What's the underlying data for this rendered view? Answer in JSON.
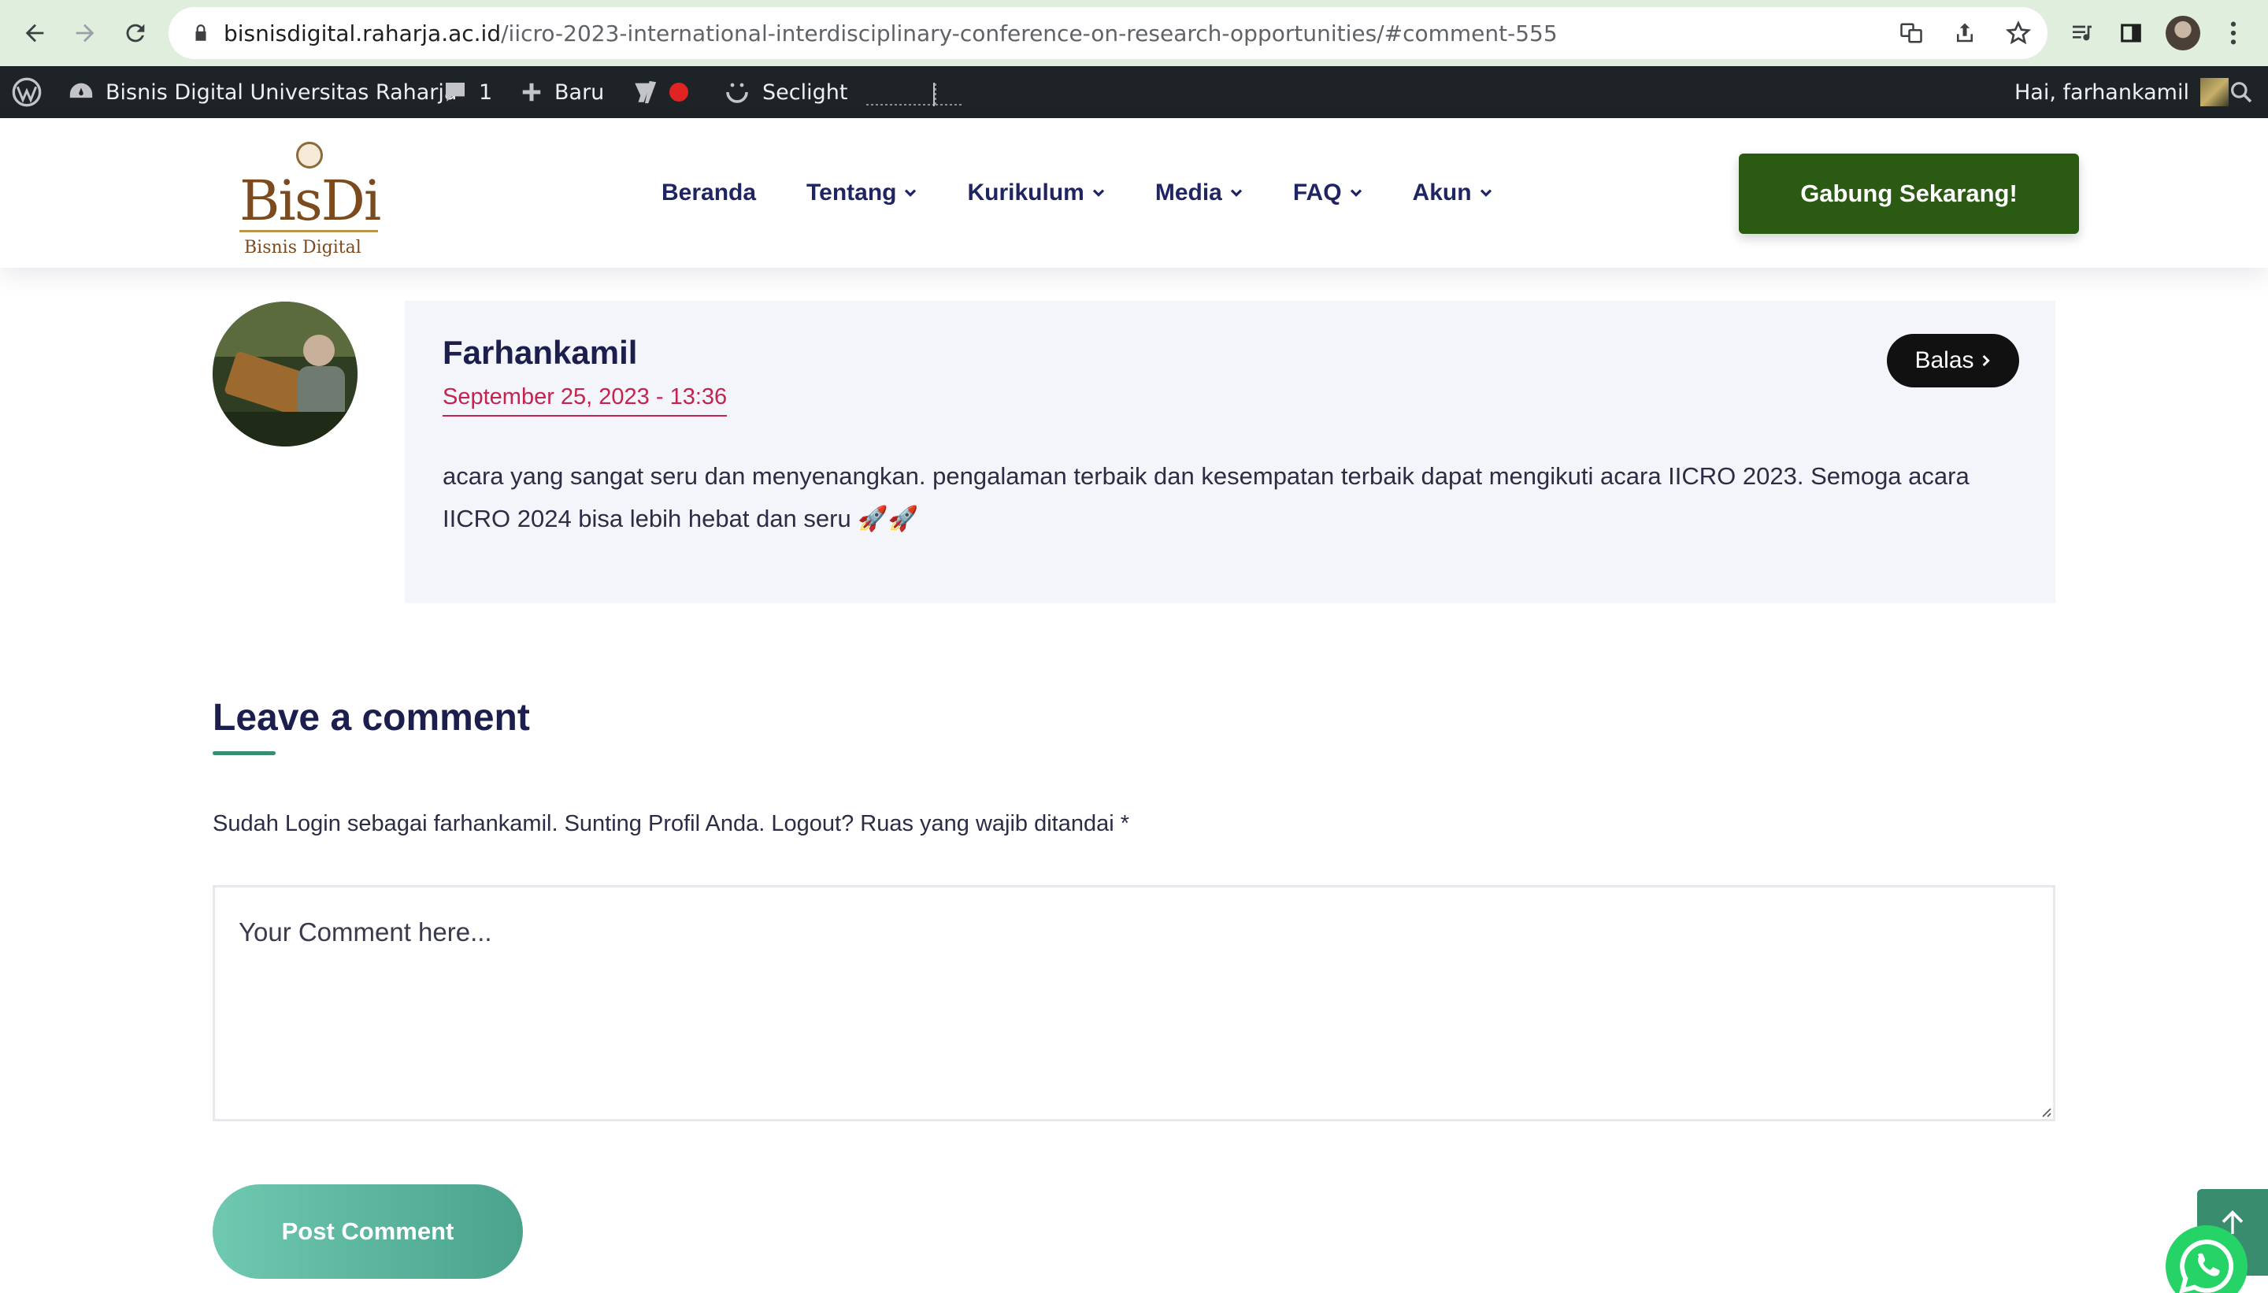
{
  "browser": {
    "url_host": "bisnisdigital.raharja.ac.id",
    "url_path": "/iicro-2023-international-interdisciplinary-conference-on-research-opportunities/#comment-555"
  },
  "admin_bar": {
    "site_name": "Bisnis Digital Universitas Raharja",
    "comments_count": "1",
    "new_label": "Baru",
    "seclight_label": "Seclight",
    "greeting": "Hai, farhankamil"
  },
  "header": {
    "logo_main": "BisDi",
    "logo_sub": "Bisnis Digital",
    "nav": [
      "Beranda",
      "Tentang",
      "Kurikulum",
      "Media",
      "FAQ",
      "Akun"
    ],
    "cta_label": "Gabung Sekarang!"
  },
  "comment": {
    "author": "Farhankamil",
    "date": "September 25, 2023 - 13:36",
    "reply_label": "Balas",
    "text": "acara yang sangat seru dan menyenangkan. pengalaman terbaik dan kesempatan terbaik dapat mengikuti acara IICRO 2023. Semoga acara IICRO 2024 bisa lebih hebat dan seru 🚀🚀"
  },
  "form": {
    "title": "Leave a comment",
    "logged_in_line": "Sudah Login sebagai farhankamil. Sunting Profil Anda. Logout? Ruas yang wajib ditandai *",
    "placeholder": "Your Comment here...",
    "submit_label": "Post Comment"
  },
  "colors": {
    "cta": "#2b5a12",
    "accent_green": "#3a8c6e",
    "date_red": "#c4234d",
    "nav_blue": "#1f2463"
  }
}
